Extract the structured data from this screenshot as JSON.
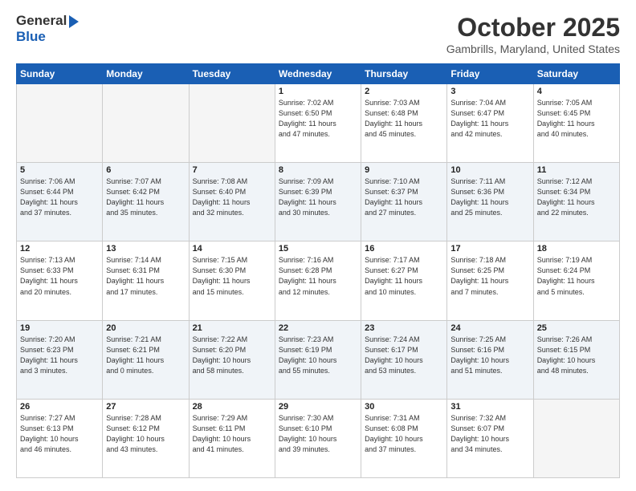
{
  "header": {
    "logo_line1": "General",
    "logo_line2": "Blue",
    "month": "October 2025",
    "location": "Gambrills, Maryland, United States"
  },
  "weekdays": [
    "Sunday",
    "Monday",
    "Tuesday",
    "Wednesday",
    "Thursday",
    "Friday",
    "Saturday"
  ],
  "weeks": [
    [
      {
        "day": "",
        "info": ""
      },
      {
        "day": "",
        "info": ""
      },
      {
        "day": "",
        "info": ""
      },
      {
        "day": "1",
        "info": "Sunrise: 7:02 AM\nSunset: 6:50 PM\nDaylight: 11 hours\nand 47 minutes."
      },
      {
        "day": "2",
        "info": "Sunrise: 7:03 AM\nSunset: 6:48 PM\nDaylight: 11 hours\nand 45 minutes."
      },
      {
        "day": "3",
        "info": "Sunrise: 7:04 AM\nSunset: 6:47 PM\nDaylight: 11 hours\nand 42 minutes."
      },
      {
        "day": "4",
        "info": "Sunrise: 7:05 AM\nSunset: 6:45 PM\nDaylight: 11 hours\nand 40 minutes."
      }
    ],
    [
      {
        "day": "5",
        "info": "Sunrise: 7:06 AM\nSunset: 6:44 PM\nDaylight: 11 hours\nand 37 minutes."
      },
      {
        "day": "6",
        "info": "Sunrise: 7:07 AM\nSunset: 6:42 PM\nDaylight: 11 hours\nand 35 minutes."
      },
      {
        "day": "7",
        "info": "Sunrise: 7:08 AM\nSunset: 6:40 PM\nDaylight: 11 hours\nand 32 minutes."
      },
      {
        "day": "8",
        "info": "Sunrise: 7:09 AM\nSunset: 6:39 PM\nDaylight: 11 hours\nand 30 minutes."
      },
      {
        "day": "9",
        "info": "Sunrise: 7:10 AM\nSunset: 6:37 PM\nDaylight: 11 hours\nand 27 minutes."
      },
      {
        "day": "10",
        "info": "Sunrise: 7:11 AM\nSunset: 6:36 PM\nDaylight: 11 hours\nand 25 minutes."
      },
      {
        "day": "11",
        "info": "Sunrise: 7:12 AM\nSunset: 6:34 PM\nDaylight: 11 hours\nand 22 minutes."
      }
    ],
    [
      {
        "day": "12",
        "info": "Sunrise: 7:13 AM\nSunset: 6:33 PM\nDaylight: 11 hours\nand 20 minutes."
      },
      {
        "day": "13",
        "info": "Sunrise: 7:14 AM\nSunset: 6:31 PM\nDaylight: 11 hours\nand 17 minutes."
      },
      {
        "day": "14",
        "info": "Sunrise: 7:15 AM\nSunset: 6:30 PM\nDaylight: 11 hours\nand 15 minutes."
      },
      {
        "day": "15",
        "info": "Sunrise: 7:16 AM\nSunset: 6:28 PM\nDaylight: 11 hours\nand 12 minutes."
      },
      {
        "day": "16",
        "info": "Sunrise: 7:17 AM\nSunset: 6:27 PM\nDaylight: 11 hours\nand 10 minutes."
      },
      {
        "day": "17",
        "info": "Sunrise: 7:18 AM\nSunset: 6:25 PM\nDaylight: 11 hours\nand 7 minutes."
      },
      {
        "day": "18",
        "info": "Sunrise: 7:19 AM\nSunset: 6:24 PM\nDaylight: 11 hours\nand 5 minutes."
      }
    ],
    [
      {
        "day": "19",
        "info": "Sunrise: 7:20 AM\nSunset: 6:23 PM\nDaylight: 11 hours\nand 3 minutes."
      },
      {
        "day": "20",
        "info": "Sunrise: 7:21 AM\nSunset: 6:21 PM\nDaylight: 11 hours\nand 0 minutes."
      },
      {
        "day": "21",
        "info": "Sunrise: 7:22 AM\nSunset: 6:20 PM\nDaylight: 10 hours\nand 58 minutes."
      },
      {
        "day": "22",
        "info": "Sunrise: 7:23 AM\nSunset: 6:19 PM\nDaylight: 10 hours\nand 55 minutes."
      },
      {
        "day": "23",
        "info": "Sunrise: 7:24 AM\nSunset: 6:17 PM\nDaylight: 10 hours\nand 53 minutes."
      },
      {
        "day": "24",
        "info": "Sunrise: 7:25 AM\nSunset: 6:16 PM\nDaylight: 10 hours\nand 51 minutes."
      },
      {
        "day": "25",
        "info": "Sunrise: 7:26 AM\nSunset: 6:15 PM\nDaylight: 10 hours\nand 48 minutes."
      }
    ],
    [
      {
        "day": "26",
        "info": "Sunrise: 7:27 AM\nSunset: 6:13 PM\nDaylight: 10 hours\nand 46 minutes."
      },
      {
        "day": "27",
        "info": "Sunrise: 7:28 AM\nSunset: 6:12 PM\nDaylight: 10 hours\nand 43 minutes."
      },
      {
        "day": "28",
        "info": "Sunrise: 7:29 AM\nSunset: 6:11 PM\nDaylight: 10 hours\nand 41 minutes."
      },
      {
        "day": "29",
        "info": "Sunrise: 7:30 AM\nSunset: 6:10 PM\nDaylight: 10 hours\nand 39 minutes."
      },
      {
        "day": "30",
        "info": "Sunrise: 7:31 AM\nSunset: 6:08 PM\nDaylight: 10 hours\nand 37 minutes."
      },
      {
        "day": "31",
        "info": "Sunrise: 7:32 AM\nSunset: 6:07 PM\nDaylight: 10 hours\nand 34 minutes."
      },
      {
        "day": "",
        "info": ""
      }
    ]
  ]
}
